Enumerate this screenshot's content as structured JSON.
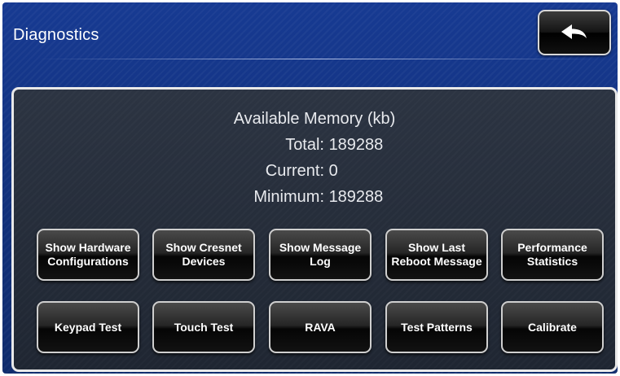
{
  "header": {
    "title": "Diagnostics",
    "back_icon": "back-arrow-icon"
  },
  "memory": {
    "heading": "Available Memory (kb)",
    "total_label": "Total:",
    "total_value": "189288",
    "current_label": "Current:",
    "current_value": "0",
    "minimum_label": "Minimum:",
    "minimum_value": "189288"
  },
  "buttons": {
    "show_hardware_line1": "Show Hardware",
    "show_hardware_line2": "Configurations",
    "show_cresnet_line1": "Show Cresnet",
    "show_cresnet_line2": "Devices",
    "show_message_line1": "Show Message",
    "show_message_line2": "Log",
    "show_last_line1": "Show Last",
    "show_last_line2": "Reboot Message",
    "performance_line1": "Performance",
    "performance_line2": "Statistics",
    "keypad_test": "Keypad Test",
    "touch_test": "Touch Test",
    "rava": "RAVA",
    "test_patterns": "Test Patterns",
    "calibrate": "Calibrate"
  },
  "colors": {
    "background": "#12327f",
    "panel": "#262d39",
    "button": "#1a1a1a",
    "text": "#ffffff"
  }
}
